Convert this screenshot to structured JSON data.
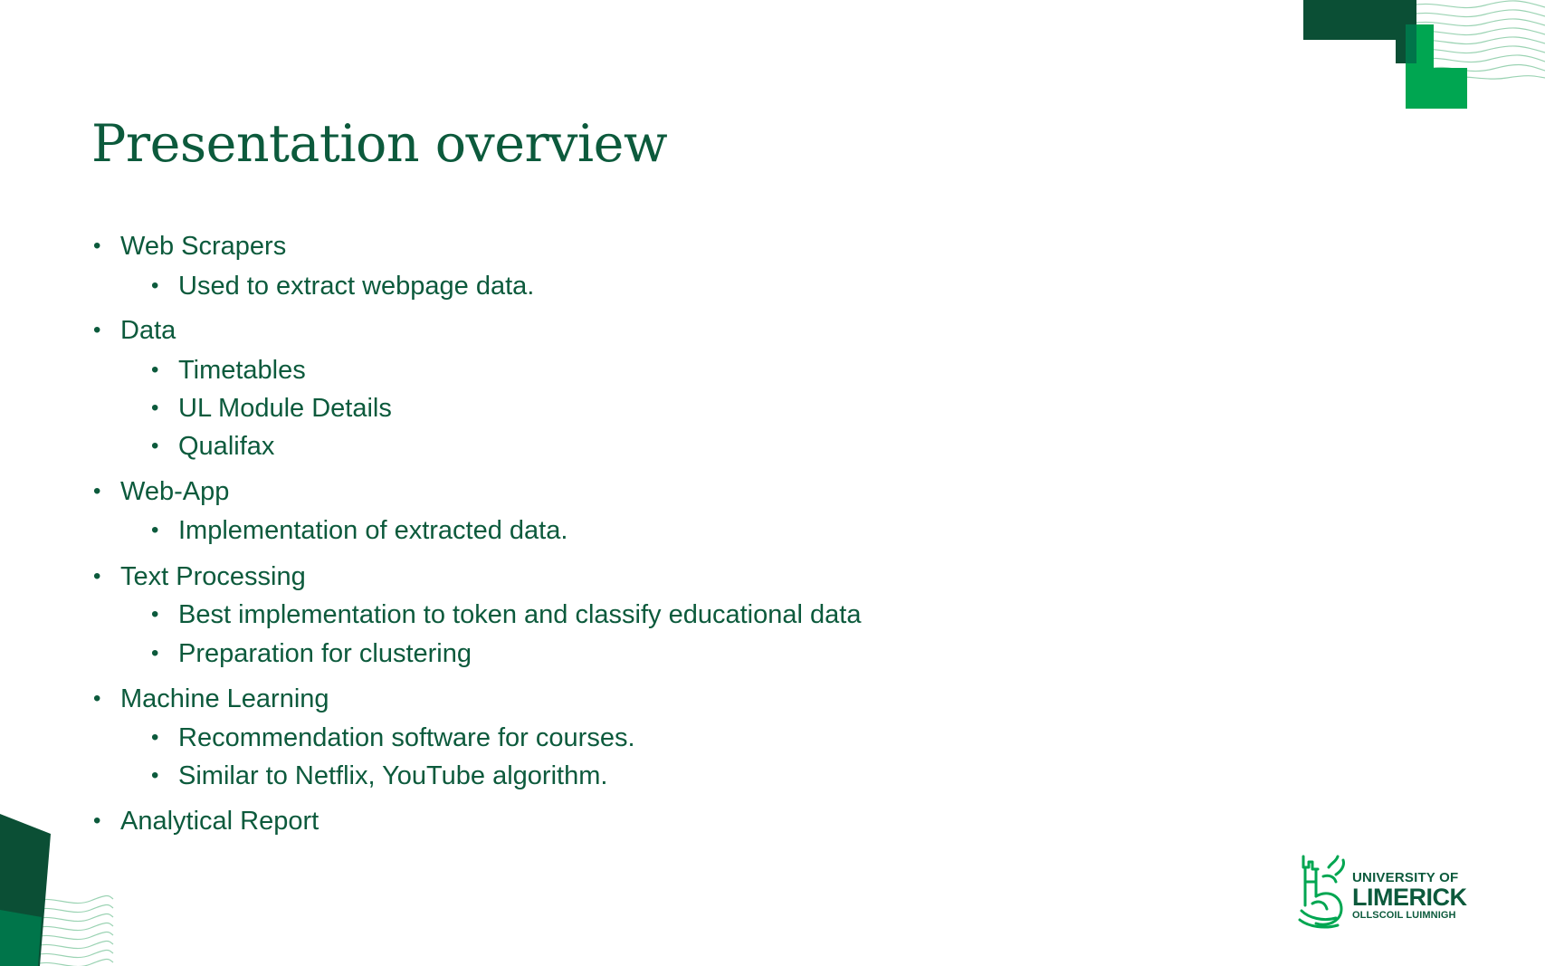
{
  "slide": {
    "title": "Presentation overview",
    "bullets": [
      {
        "text": "Web Scrapers",
        "level": 1
      },
      {
        "text": "Used to extract webpage data.",
        "level": 2
      },
      {
        "text": "Data",
        "level": 1
      },
      {
        "text": "Timetables",
        "level": 2
      },
      {
        "text": "UL Module Details",
        "level": 2
      },
      {
        "text": "Qualifax",
        "level": 2
      },
      {
        "text": "Web-App",
        "level": 1
      },
      {
        "text": "Implementation of extracted data.",
        "level": 2
      },
      {
        "text": "Text Processing",
        "level": 1
      },
      {
        "text": "Best implementation to token and classify educational data",
        "level": 2
      },
      {
        "text": "Preparation for clustering",
        "level": 2
      },
      {
        "text": "Machine Learning",
        "level": 1
      },
      {
        "text": "Recommendation software for courses.",
        "level": 2
      },
      {
        "text": "Similar to Netflix, YouTube algorithm.",
        "level": 2
      },
      {
        "text": "Analytical Report",
        "level": 1
      }
    ],
    "bullet_glyph": "•"
  },
  "logo": {
    "line1": "UNIVERSITY OF",
    "line2": "LIMERICK",
    "line3": "OLLSCOIL LUIMNIGH",
    "icon": "ul-crest-icon"
  },
  "colors": {
    "text": "#0c5a3c",
    "dark_green": "#0b4f35",
    "bright_green": "#00a651",
    "wave_green": "#9bd3b3"
  }
}
